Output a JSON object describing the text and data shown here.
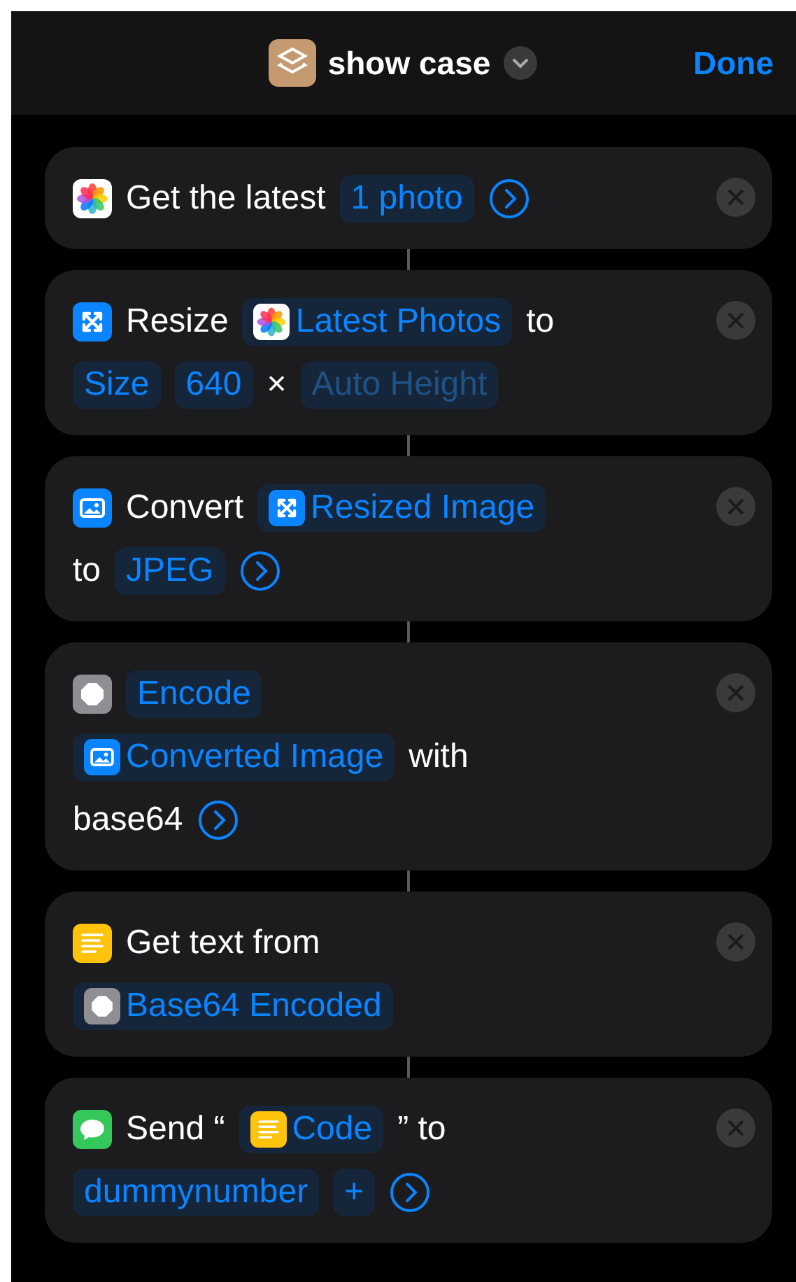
{
  "header": {
    "title": "show case",
    "done": "Done"
  },
  "actions": [
    {
      "kind": "photos",
      "lines": [
        [
          {
            "kind": "text",
            "text": "Get the latest"
          },
          {
            "kind": "pill",
            "text": "1 photo"
          },
          {
            "kind": "more"
          }
        ]
      ]
    },
    {
      "kind": "resize",
      "lines": [
        [
          {
            "kind": "text",
            "text": "Resize"
          },
          {
            "kind": "variable",
            "text": "Latest Photos"
          },
          {
            "kind": "text",
            "text": "to"
          }
        ],
        [
          {
            "kind": "pill",
            "text": "Size"
          },
          {
            "kind": "pill",
            "text": "640"
          },
          {
            "kind": "text",
            "text": "×"
          },
          {
            "kind": "placeholder",
            "text": "Auto Height"
          }
        ]
      ]
    },
    {
      "kind": "convert",
      "lines": [
        [
          {
            "kind": "text",
            "text": "Convert"
          },
          {
            "kind": "variable",
            "text": "Resized Image"
          }
        ],
        [
          {
            "kind": "text",
            "text": "to"
          },
          {
            "kind": "pill",
            "text": "JPEG"
          },
          {
            "kind": "more"
          }
        ]
      ]
    },
    {
      "kind": "encode",
      "lines": [
        [
          {
            "kind": "pill",
            "text": "Encode"
          }
        ],
        [
          {
            "kind": "variable",
            "text": "Converted Image"
          },
          {
            "kind": "text",
            "text": "with"
          }
        ],
        [
          {
            "kind": "text",
            "text": "base64"
          },
          {
            "kind": "more"
          }
        ]
      ]
    },
    {
      "kind": "text",
      "lines": [
        [
          {
            "kind": "text",
            "text": "Get text from"
          }
        ],
        [
          {
            "kind": "variable",
            "text": "Base64 Encoded"
          }
        ]
      ]
    },
    {
      "kind": "message",
      "lines": [
        [
          {
            "kind": "text",
            "text": "Send “"
          },
          {
            "kind": "variable",
            "text": "Code"
          },
          {
            "kind": "text",
            "text": "” to"
          }
        ],
        [
          {
            "kind": "pill",
            "text": "dummynumber"
          },
          {
            "kind": "pill",
            "text": "+"
          },
          {
            "kind": "more"
          }
        ]
      ]
    }
  ]
}
